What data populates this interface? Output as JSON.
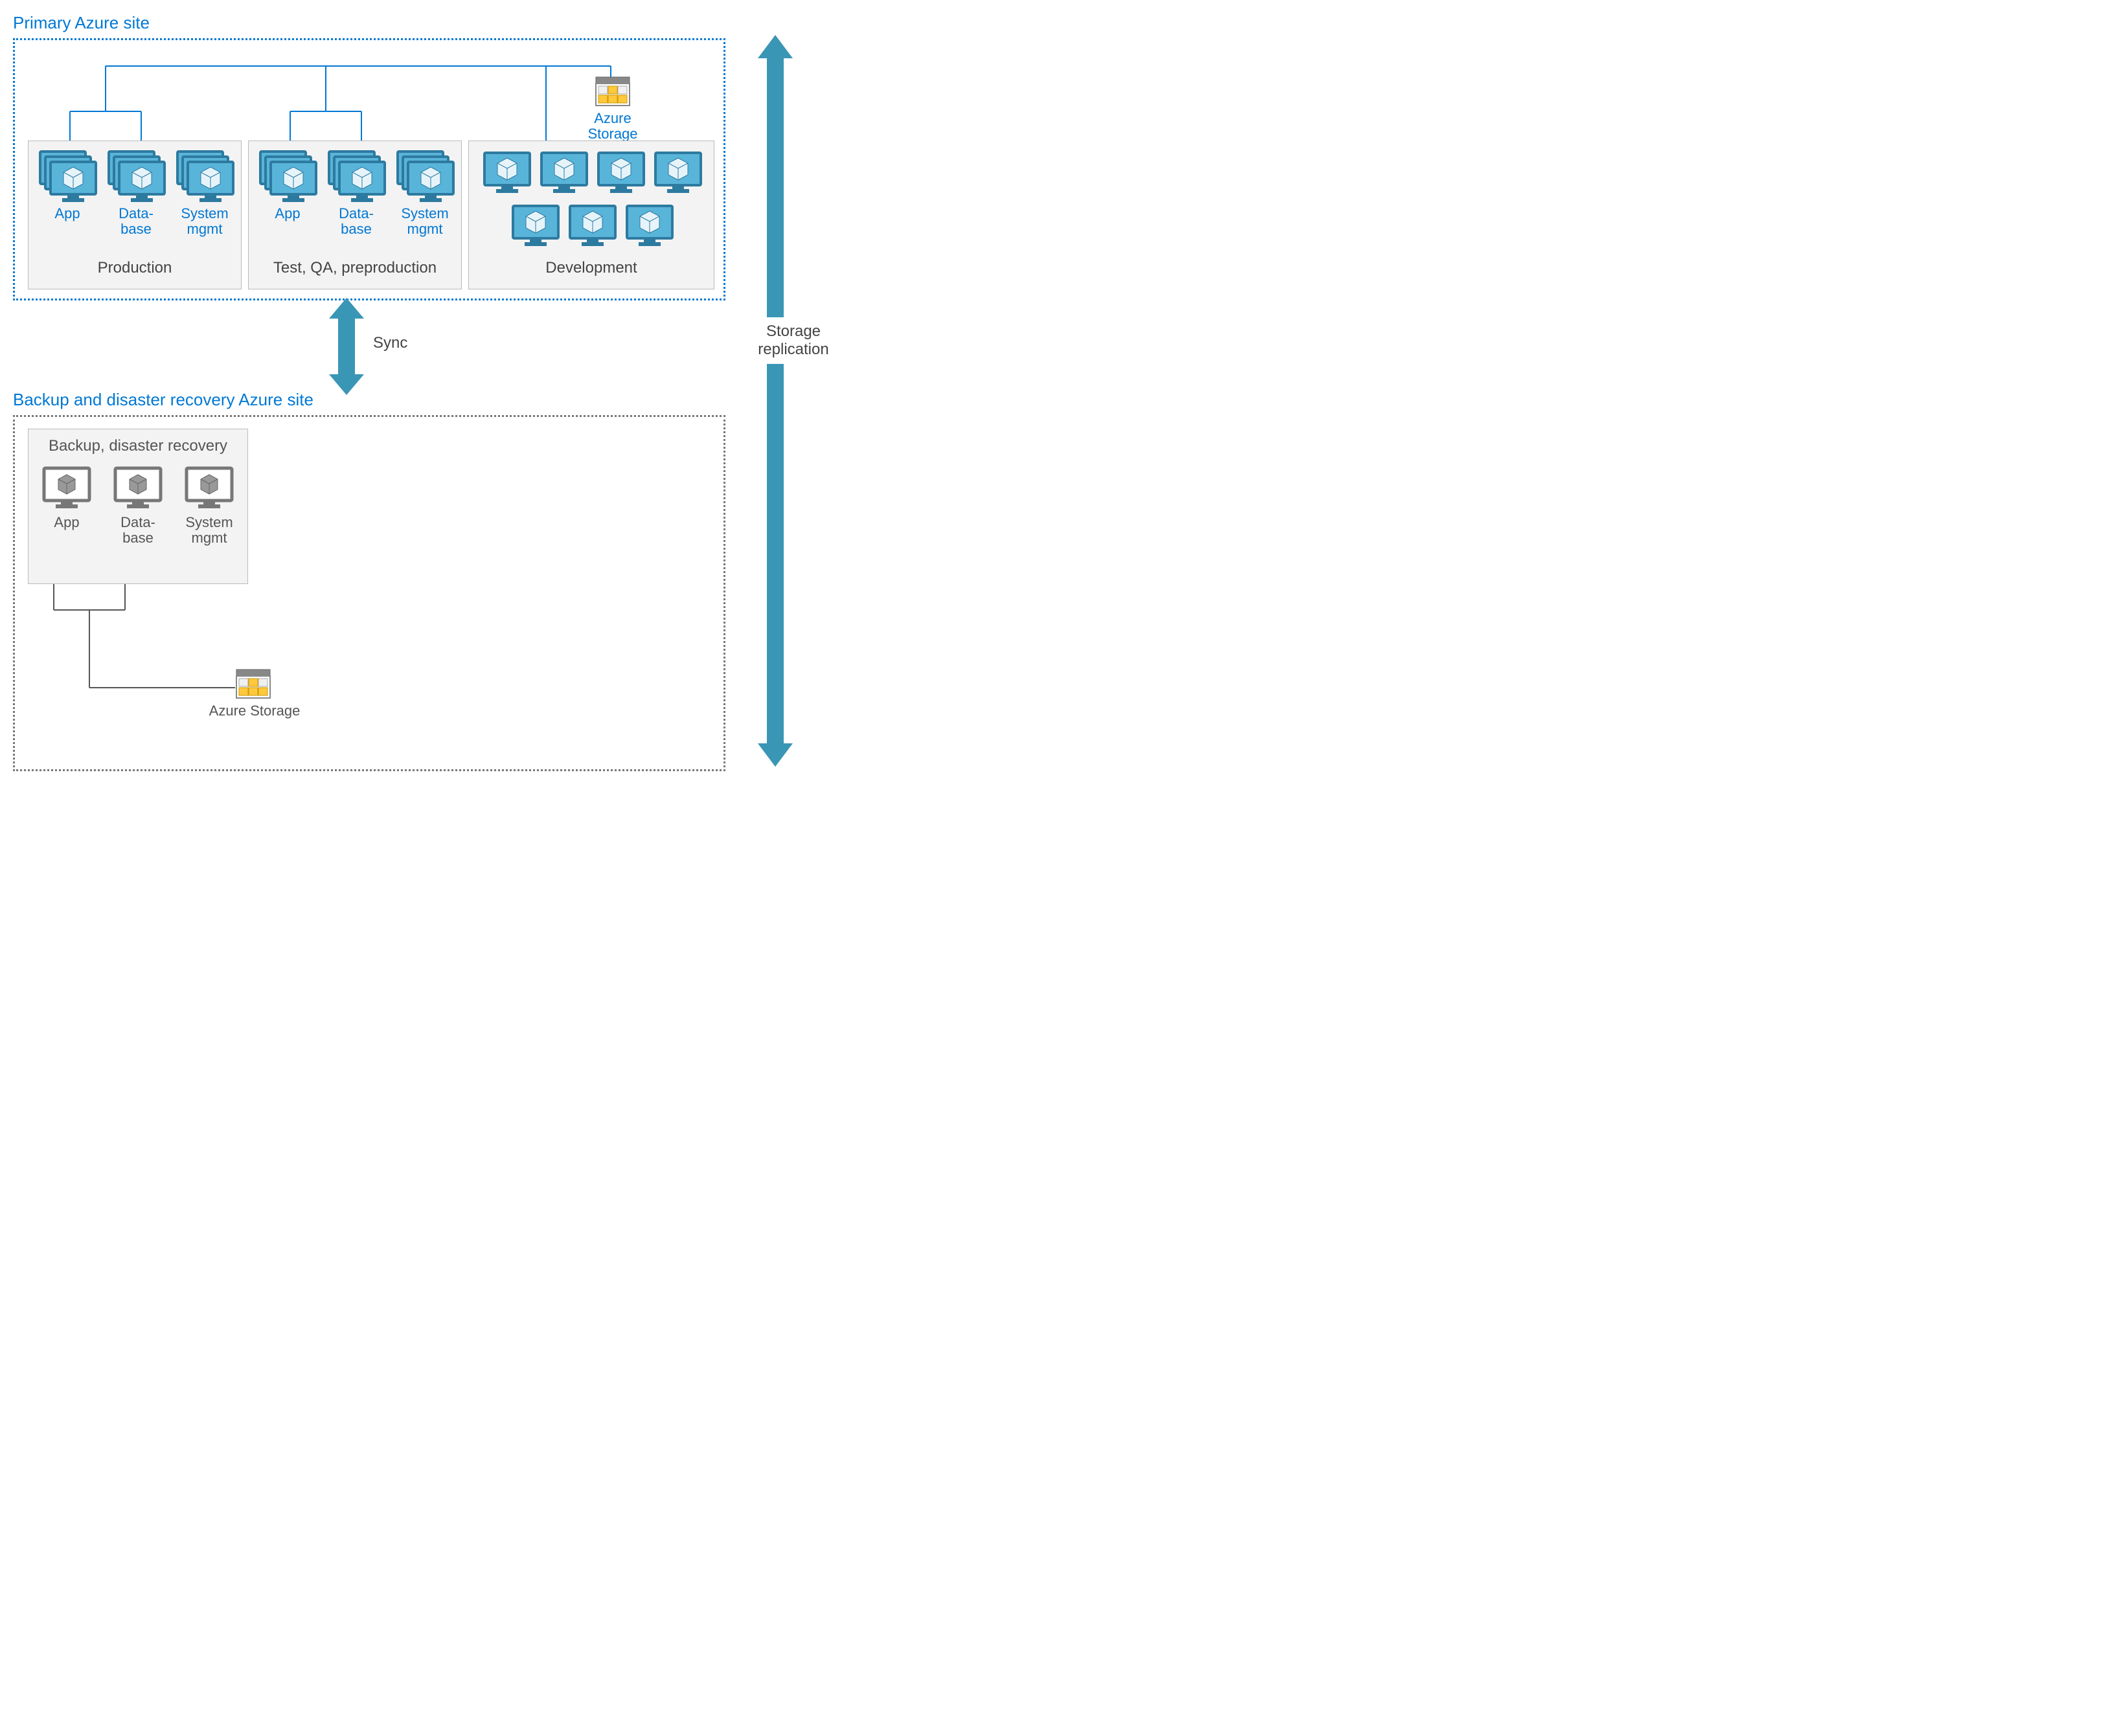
{
  "primary": {
    "title": "Primary Azure site",
    "storage": "Azure Storage",
    "envs": {
      "prod": {
        "title": "Production",
        "app": "App",
        "db": "Data-\nbase",
        "sys": "System\nmgmt"
      },
      "test": {
        "title": "Test, QA, preproduction",
        "app": "App",
        "db": "Data-\nbase",
        "sys": "System\nmgmt"
      },
      "dev": {
        "title": "Development"
      }
    }
  },
  "backup": {
    "title": "Backup and disaster recovery Azure site",
    "storage": "Azure Storage",
    "env": {
      "title": "Backup, disaster recovery",
      "app": "App",
      "db": "Data-\nbase",
      "sys": "System\nmgmt"
    }
  },
  "sync": "Sync",
  "replication": "Storage\nreplication"
}
